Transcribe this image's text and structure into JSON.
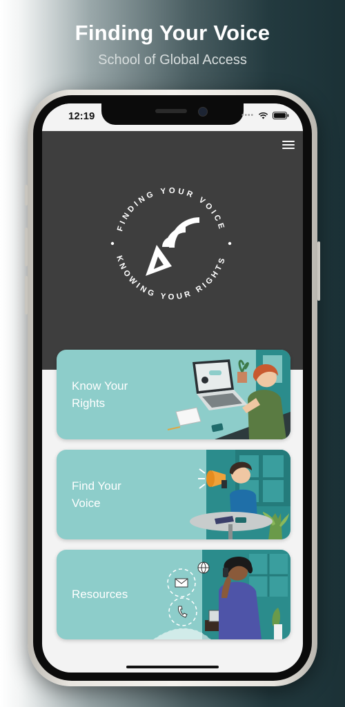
{
  "header": {
    "title": "Finding Your Voice",
    "subtitle": "School of Global Access"
  },
  "status_bar": {
    "time": "12:19"
  },
  "logo": {
    "top_text": "FINDING YOUR VOICE",
    "bottom_text": "KNOWING YOUR RIGHTS"
  },
  "cards": [
    {
      "label": "Know Your\nRights",
      "icon": "laptop-illustration"
    },
    {
      "label": "Find Your\nVoice",
      "icon": "megaphone-illustration"
    },
    {
      "label": "Resources",
      "icon": "phone-call-illustration"
    }
  ],
  "colors": {
    "header_bg": "#3e3e3e",
    "card_bg": "#8dcdca",
    "accent_dark": "#2b8c8c"
  }
}
